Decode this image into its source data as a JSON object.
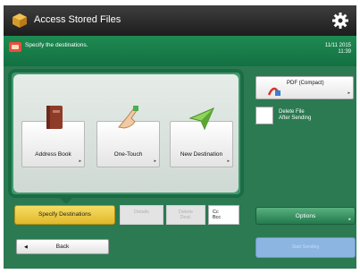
{
  "header": {
    "title": "Access Stored Files",
    "icon": "folder-box-icon",
    "settings_icon": "gear-icon"
  },
  "message_bar": {
    "text": "Specify the destinations.",
    "date": "11/11 2015",
    "time": "11:39"
  },
  "destinations": [
    {
      "label": "Address Book",
      "icon": "address-book-icon"
    },
    {
      "label": "One-Touch",
      "icon": "one-touch-hand-icon"
    },
    {
      "label": "New Destination",
      "icon": "paper-plane-icon"
    }
  ],
  "tabs": {
    "specify": "Specify Destinations",
    "details_line1": "Details",
    "delete_line1": "Delete",
    "delete_line2": "Dest.",
    "cc_line1": "Cc",
    "cc_line2": "Bcc"
  },
  "back": {
    "label": "Back"
  },
  "file_format": {
    "label": "PDF (Compact)",
    "icon": "pdf-icon"
  },
  "delete_after": {
    "line1": "Delete File",
    "line2": "After Sending",
    "checked": false
  },
  "options": {
    "label": "Options"
  },
  "start": {
    "label": "Start Sending"
  },
  "colors": {
    "header_green": "#1e8a52",
    "body_green": "#2b7a52",
    "tab_yellow": "#f0cf4a",
    "start_blue": "#8db5e1"
  }
}
